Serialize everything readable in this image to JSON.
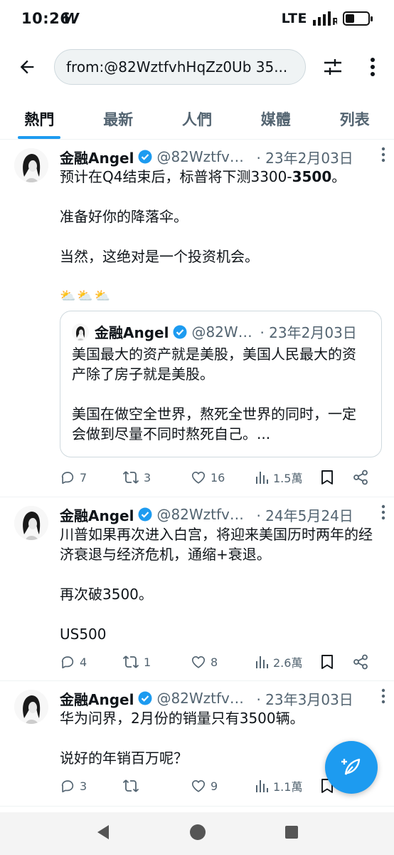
{
  "status_bar": {
    "time": "10:26",
    "app_letter": "W",
    "network": "LTE"
  },
  "search": {
    "query": "from:@82WztfvhHqZz0Ub  35..."
  },
  "tabs": [
    {
      "label": "熱門",
      "active": true
    },
    {
      "label": "最新",
      "active": false
    },
    {
      "label": "人們",
      "active": false
    },
    {
      "label": "媒體",
      "active": false
    },
    {
      "label": "列表",
      "active": false
    }
  ],
  "colors": {
    "accent": "#1d9bf0",
    "text": "#0f1419",
    "muted": "#536471"
  },
  "tweets": [
    {
      "name": "金融Angel",
      "handle": "@82Wztfvh...",
      "date": "· 23年2月03日",
      "text1": "预计在Q4结束后，标普将下测3300-",
      "text1_bold": "3500",
      "text1_end": "。",
      "text2": "准备好你的降落伞。",
      "text3": "当然，这绝对是一个投资机会。",
      "text4": "⛅⛅⛅",
      "quote": {
        "name": "金融Angel",
        "handle": "@82Wztf...",
        "date": "· 23年2月03日",
        "text1": "美国最大的资产就是美股，美国人民最大的资产除了房子就是美股。",
        "text2": "美国在做空全世界，熬死全世界的同时，一定会做到尽量不同时熬死自己。..."
      },
      "replies": "7",
      "retweets": "3",
      "likes": "16",
      "views": "1.5萬"
    },
    {
      "name": "金融Angel",
      "handle": "@82Wztfvh...",
      "date": "· 24年5月24日",
      "text1": "川普如果再次进入白宫，将迎来美国历时两年的经济衰退与经济危机，通缩+衰退。",
      "text2": "再次破3500。",
      "text3": "US500",
      "replies": "4",
      "retweets": "1",
      "likes": "8",
      "views": "2.6萬"
    },
    {
      "name": "金融Angel",
      "handle": "@82Wztfvh...",
      "date": "· 23年3月03日",
      "text1": "华为问界，2月份的销量只有3500辆。",
      "text2": "说好的年销百万呢？",
      "replies": "3",
      "retweets": "",
      "likes": "9",
      "views": "1.1萬"
    }
  ]
}
